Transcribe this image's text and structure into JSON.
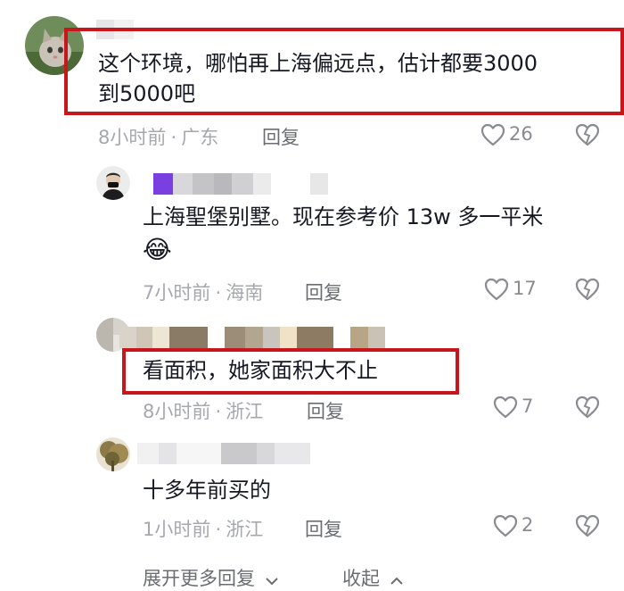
{
  "comments": [
    {
      "text_lines": [
        "这个环境，哪怕再上海偏远点，估计都要3000",
        "到5000吧"
      ],
      "time": "8小时前",
      "location": "广东",
      "reply_label": "回复",
      "likes": "26",
      "highlighted": true
    },
    {
      "text_lines": [
        "上海聖堡别墅。现在参考价 13w 多一平米"
      ],
      "emoji": "😂",
      "time": "7小时前",
      "location": "海南",
      "reply_label": "回复",
      "likes": "17"
    },
    {
      "text_lines": [
        "看面积，她家面积大不止"
      ],
      "time": "8小时前",
      "location": "浙江",
      "reply_label": "回复",
      "likes": "7",
      "highlighted": true
    },
    {
      "text_lines": [
        "十多年前买的"
      ],
      "time": "1小时前",
      "location": "浙江",
      "reply_label": "回复",
      "likes": "2"
    }
  ],
  "footer": {
    "expand_label": "展开更多回复",
    "collapse_label": "收起"
  },
  "meta_separator": "·",
  "colors": {
    "highlight_box": "#c8161d",
    "meta_text": "#a6a8ad",
    "body_text": "#161823"
  },
  "icons": [
    "heart-icon",
    "dislike-heart-icon",
    "chevron-down-icon",
    "chevron-up-icon",
    "avatar-cat",
    "avatar-man",
    "avatar-blurred",
    "avatar-tree"
  ]
}
